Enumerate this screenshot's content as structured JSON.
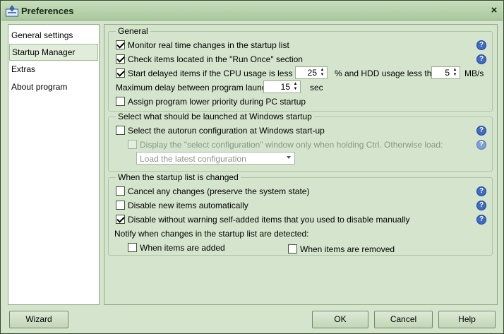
{
  "window": {
    "title": "Preferences",
    "close_glyph": "×",
    "app_icon": "flower-icon"
  },
  "sidebar": {
    "items": [
      {
        "label": "General settings"
      },
      {
        "label": "Startup Manager"
      },
      {
        "label": "Extras"
      },
      {
        "label": "About program"
      }
    ],
    "selected_index": 1
  },
  "general": {
    "title": "General",
    "monitor": {
      "label": "Monitor real time changes in the startup list",
      "checked": true
    },
    "run_once": {
      "label": "Check items located in the \"Run Once\" section",
      "checked": true
    },
    "delayed": {
      "label_start": "Start delayed items if the CPU usage is less than",
      "cpu_value": "25",
      "label_mid": "% and HDD usage less than",
      "hdd_value": "5",
      "label_end": "MB/s",
      "checked": true
    },
    "max_delay": {
      "label": "Maximum delay between program launches",
      "value": "15",
      "unit": "sec"
    },
    "lower_priority": {
      "label": "Assign program lower priority during PC startup",
      "checked": false
    }
  },
  "autorun": {
    "title": "Select what should be launched at Windows startup",
    "select_config": {
      "label": "Select the autorun configuration at Windows start-up",
      "checked": false
    },
    "display_window": {
      "label": "Display the \"select configuration\" window only when holding Ctrl. Otherwise load:",
      "checked": false,
      "disabled": true
    },
    "config_select": {
      "value": "Load the latest configuration"
    }
  },
  "changes": {
    "title": "When the startup list is changed",
    "cancel": {
      "label": "Cancel any changes (preserve the system state)",
      "checked": false
    },
    "disable_new": {
      "label": "Disable new items automatically",
      "checked": false
    },
    "disable_self": {
      "label": "Disable without warning self-added items that you used to disable manually",
      "checked": true
    },
    "notify_label": "Notify when changes in the startup list are detected:",
    "added": {
      "label": "When items are added",
      "checked": false
    },
    "removed": {
      "label": "When items are removed",
      "checked": false
    }
  },
  "help_glyph": "?",
  "buttons": {
    "wizard": "Wizard",
    "ok": "OK",
    "cancel": "Cancel",
    "help": "Help"
  }
}
